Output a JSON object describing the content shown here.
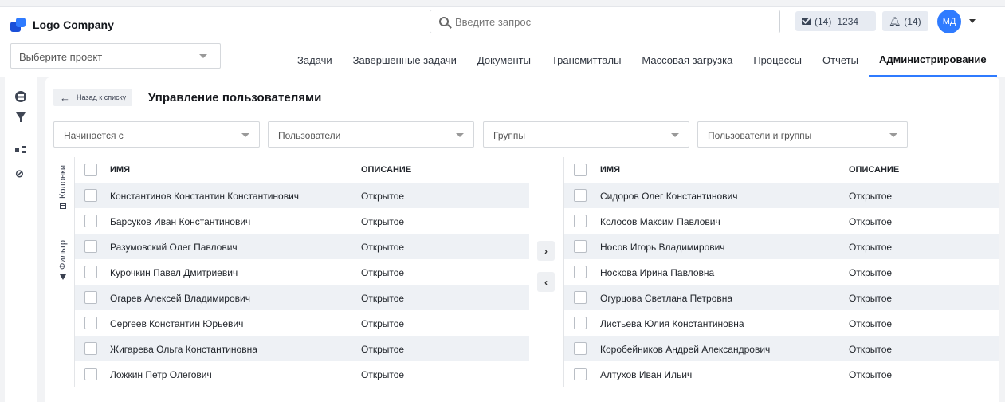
{
  "header": {
    "logo_text": "Logo Company",
    "search_placeholder": "Введите запрос",
    "mail_count": "(14)",
    "mail_number": "1234",
    "bell_count": "(14)",
    "avatar_initials": "МД"
  },
  "nav": {
    "project_placeholder": "Выберите проект",
    "tabs": [
      {
        "label": "Задачи"
      },
      {
        "label": "Завершенные задачи"
      },
      {
        "label": "Документы"
      },
      {
        "label": "Трансмитталы"
      },
      {
        "label": "Массовая загрузка"
      },
      {
        "label": "Процессы"
      },
      {
        "label": "Отчеты"
      },
      {
        "label": "Администрирование",
        "active": true
      }
    ]
  },
  "page": {
    "back_label": "Назад к списку",
    "title": "Управление пользователями"
  },
  "filters": {
    "starts_with": "Начинается с",
    "users": "Пользователи",
    "groups": "Группы",
    "users_and_groups": "Пользователи и группы"
  },
  "side_labels": {
    "columns": "Колонки",
    "filter": "Фильтр"
  },
  "table_headers": {
    "name": "ИМЯ",
    "description": "ОПИСАНИЕ"
  },
  "left_rows": [
    {
      "name": "Константинов Константин Константинович",
      "description": "Открытое"
    },
    {
      "name": "Барсуков Иван Константинович",
      "description": "Открытое"
    },
    {
      "name": "Разумовский Олег Павлович",
      "description": "Открытое"
    },
    {
      "name": "Курочкин Павел Дмитриевич",
      "description": "Открытое"
    },
    {
      "name": "Огарев Алексей Владимирович",
      "description": "Открытое"
    },
    {
      "name": "Сергеев Константин Юрьевич",
      "description": "Открытое"
    },
    {
      "name": "Жигарева Ольга Константиновна",
      "description": "Открытое"
    },
    {
      "name": "Ложкин Петр Олегович",
      "description": "Открытое"
    }
  ],
  "right_rows": [
    {
      "name": "Сидоров Олег Константинович",
      "description": "Открытое"
    },
    {
      "name": "Колосов  Максим Павлович",
      "description": "Открытое"
    },
    {
      "name": "Носов Игорь Владимирович",
      "description": "Открытое"
    },
    {
      "name": "Носкова Ирина Павловна",
      "description": "Открытое"
    },
    {
      "name": "Огурцова Светлана Петровна",
      "description": "Открытое"
    },
    {
      "name": "Листьева Юлия Константиновна",
      "description": "Открытое"
    },
    {
      "name": "Коробейников Андрей Александрович",
      "description": "Открытое"
    },
    {
      "name": "Алтухов Иван Ильич",
      "description": "Открытое"
    }
  ],
  "transfer": {
    "move_right": "›",
    "move_left": "‹"
  },
  "colors": {
    "accent": "#2f7bff",
    "row_alt": "#eef1f5",
    "background": "#f2f3f5"
  }
}
